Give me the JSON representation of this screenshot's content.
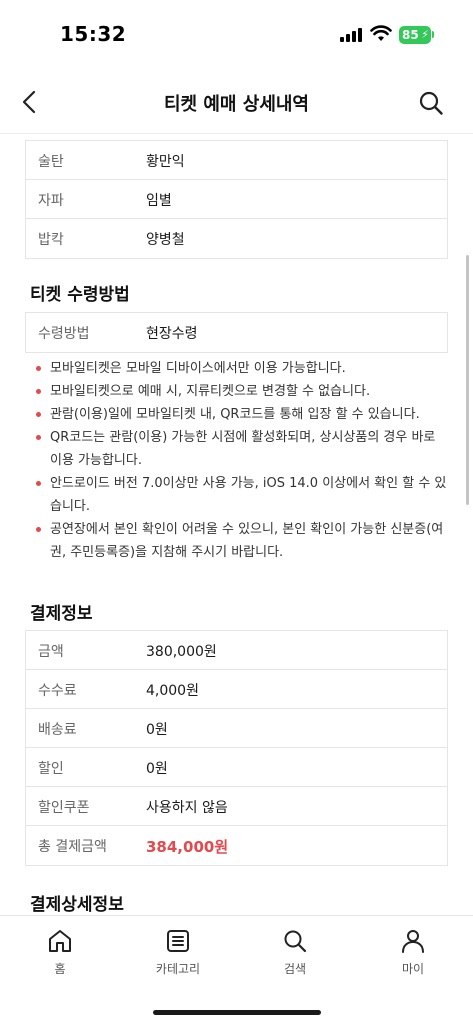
{
  "status_bar": {
    "time": "15:32",
    "battery": "85"
  },
  "header": {
    "title": "티켓 예매 상세내역"
  },
  "cast_table": [
    {
      "key": "술탄",
      "value": "황만익"
    },
    {
      "key": "자파",
      "value": "임별"
    },
    {
      "key": "밥칵",
      "value": "양병철"
    }
  ],
  "receive_section": {
    "title": "티켓 수령방법",
    "rows": [
      {
        "key": "수령방법",
        "value": "현장수령"
      }
    ],
    "notes": [
      "모바일티켓은 모바일 디바이스에서만 이용 가능합니다.",
      "모바일티켓으로 예매 시, 지류티켓으로 변경할 수 없습니다.",
      "관람(이용)일에 모바일티켓 내, QR코드를 통해 입장 할 수 있습니다.",
      "QR코드는 관람(이용) 가능한 시점에 활성화되며, 상시상품의 경우 바로 이용 가능합니다.",
      "안드로이드 버전 7.0이상만 사용 가능, iOS 14.0 이상에서 확인 할 수 있습니다.",
      "공연장에서 본인 확인이 어려울 수 있으니, 본인 확인이 가능한 신분증(여권, 주민등록증)을 지참해 주시기 바랍니다."
    ]
  },
  "payment_section": {
    "title": "결제정보",
    "rows": [
      {
        "key": "금액",
        "value": "380,000원"
      },
      {
        "key": "수수료",
        "value": "4,000원"
      },
      {
        "key": "배송료",
        "value": "0원"
      },
      {
        "key": "할인",
        "value": "0원"
      },
      {
        "key": "할인쿠폰",
        "value": "사용하지 않음"
      },
      {
        "key": "총 결제금액",
        "value": "384,000원"
      }
    ]
  },
  "payment_detail_section": {
    "title": "결제상세정보"
  },
  "tabbar": {
    "items": [
      {
        "label": "홈",
        "icon": "home-icon"
      },
      {
        "label": "카테고리",
        "icon": "category-icon"
      },
      {
        "label": "검색",
        "icon": "search-icon"
      },
      {
        "label": "마이",
        "icon": "profile-icon"
      }
    ]
  },
  "colors": {
    "accent": "#e5484d",
    "battery": "#34c759"
  }
}
